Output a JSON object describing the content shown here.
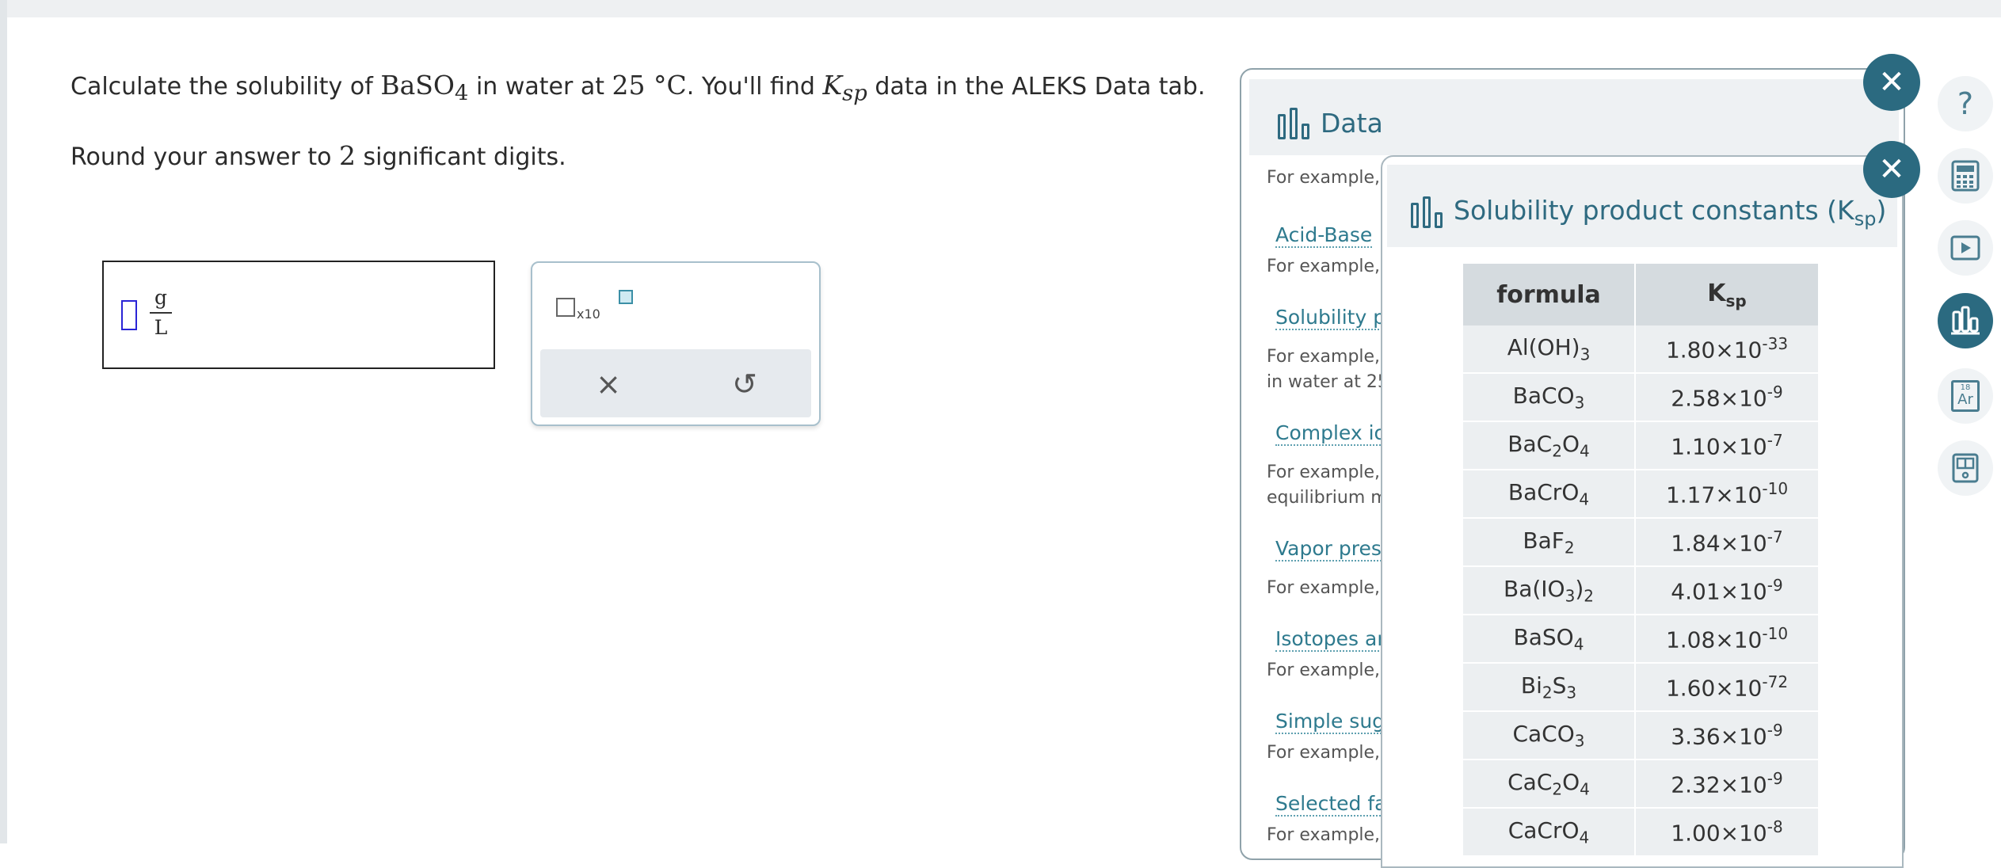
{
  "question": {
    "p1": "Calculate the solubility of ",
    "compound": "BaSO",
    "compound_sub": "4",
    "p2": " in water at ",
    "temp": "25 °C",
    "p3": ". You'll find ",
    "k": "K",
    "k_sub": "sp",
    "p4": " data in the ALEKS Data tab.",
    "round_pre": "Round your answer to ",
    "round_n": "2",
    "round_post": " significant digits."
  },
  "answer": {
    "unit_num": "g",
    "unit_den": "L"
  },
  "toolbox": {
    "x10_label": "x10",
    "clear_symbol": "×",
    "undo_symbol": "↺"
  },
  "data_panel": {
    "title": "Data",
    "items": [
      {
        "link": "",
        "example": "For example,"
      },
      {
        "link": "Acid-Base",
        "example": "For example,"
      },
      {
        "link": "Solubility p",
        "example": "For example,",
        "example2": "in water at 25"
      },
      {
        "link": "Complex io",
        "example": "For example,",
        "example2": "equilibrium m"
      },
      {
        "link": "Vapor pres",
        "example": "For example,"
      },
      {
        "link": "Isotopes ar",
        "example": "For example,"
      },
      {
        "link": "Simple sug",
        "example": "For example,"
      },
      {
        "link": "Selected fa",
        "example": "For example,"
      }
    ]
  },
  "ksp_panel": {
    "title": "Solubility product constants (K",
    "title_sub": "sp",
    "title_end": ")",
    "col_formula": "formula",
    "col_k": "K",
    "col_k_sub": "sp",
    "rows": [
      {
        "formula": [
          "Al(OH)",
          "3",
          ""
        ],
        "mant": "1.80×10",
        "exp": "-33"
      },
      {
        "formula": [
          "BaCO",
          "3",
          ""
        ],
        "mant": "2.58×10",
        "exp": "-9"
      },
      {
        "formula": [
          "BaC",
          "2",
          "O",
          "4"
        ],
        "mant": "1.10×10",
        "exp": "-7"
      },
      {
        "formula": [
          "BaCrO",
          "4",
          ""
        ],
        "mant": "1.17×10",
        "exp": "-10"
      },
      {
        "formula": [
          "BaF",
          "2",
          ""
        ],
        "mant": "1.84×10",
        "exp": "-7"
      },
      {
        "formula": [
          "Ba(IO",
          "3",
          ")",
          "2"
        ],
        "mant": "4.01×10",
        "exp": "-9"
      },
      {
        "formula": [
          "BaSO",
          "4",
          ""
        ],
        "mant": "1.08×10",
        "exp": "-10"
      },
      {
        "formula": [
          "Bi",
          "2",
          "S",
          "3"
        ],
        "mant": "1.60×10",
        "exp": "-72"
      },
      {
        "formula": [
          "CaCO",
          "3",
          ""
        ],
        "mant": "3.36×10",
        "exp": "-9"
      },
      {
        "formula": [
          "CaC",
          "2",
          "O",
          "4"
        ],
        "mant": "2.32×10",
        "exp": "-9"
      },
      {
        "formula": [
          "CaCrO",
          "4",
          ""
        ],
        "mant": "1.00×10",
        "exp": "-8"
      }
    ]
  },
  "close_symbol": "✕",
  "rail": {
    "help": "?",
    "periodic_top": "18",
    "periodic_symbol": "Ar"
  }
}
